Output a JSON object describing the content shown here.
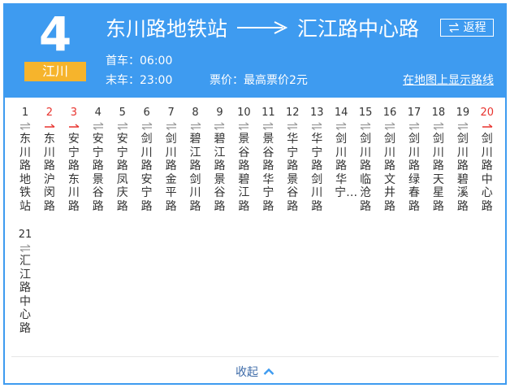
{
  "route": {
    "number": "4",
    "line_badge": "江川",
    "origin": "东川路地铁站",
    "destination": "汇江路中心路",
    "return_label": "返程",
    "first_bus": "首车：06:00",
    "last_bus": "末车：23:00",
    "fare": "票价：最高票价2元",
    "map_link": "在地图上显示路线"
  },
  "stations": [
    {
      "index": "1",
      "name": "东川路地铁站",
      "arrow": "both-icon",
      "highlight": false
    },
    {
      "index": "2",
      "name": "东川路沪闵路",
      "arrow": "right-arrow-icon",
      "highlight": true
    },
    {
      "index": "3",
      "name": "安宁路东川路",
      "arrow": "right-arrow-icon",
      "highlight": true
    },
    {
      "index": "4",
      "name": "安宁路景谷路",
      "arrow": "both-icon",
      "highlight": false
    },
    {
      "index": "5",
      "name": "安宁路凤庆路",
      "arrow": "both-icon",
      "highlight": false
    },
    {
      "index": "6",
      "name": "剑川路安宁路",
      "arrow": "both-icon",
      "highlight": false
    },
    {
      "index": "7",
      "name": "剑川路金平路",
      "arrow": "both-icon",
      "highlight": false
    },
    {
      "index": "8",
      "name": "碧江路剑川路",
      "arrow": "both-icon",
      "highlight": false
    },
    {
      "index": "9",
      "name": "碧江路景谷路",
      "arrow": "both-icon",
      "highlight": false
    },
    {
      "index": "10",
      "name": "景谷路碧江路",
      "arrow": "both-icon",
      "highlight": false
    },
    {
      "index": "11",
      "name": "景谷路华宁路",
      "arrow": "both-icon",
      "highlight": false
    },
    {
      "index": "12",
      "name": "华宁路景谷路",
      "arrow": "both-icon",
      "highlight": false
    },
    {
      "index": "13",
      "name": "华宁路剑川路",
      "arrow": "both-icon",
      "highlight": false
    },
    {
      "index": "14",
      "name": "剑川路华宁…",
      "arrow": "both-icon",
      "highlight": false
    },
    {
      "index": "15",
      "name": "剑川路临沧路",
      "arrow": "both-icon",
      "highlight": false
    },
    {
      "index": "16",
      "name": "剑川路文井路",
      "arrow": "both-icon",
      "highlight": false
    },
    {
      "index": "17",
      "name": "剑川路绿春路",
      "arrow": "both-icon",
      "highlight": false
    },
    {
      "index": "18",
      "name": "剑川路天星路",
      "arrow": "both-icon",
      "highlight": false
    },
    {
      "index": "19",
      "name": "剑川路碧溪路",
      "arrow": "both-icon",
      "highlight": false
    },
    {
      "index": "20",
      "name": "剑川路中心路",
      "arrow": "right-arrow-icon",
      "highlight": true
    },
    {
      "index": "21",
      "name": "汇江路中心路",
      "arrow": "both-icon",
      "highlight": false
    }
  ],
  "footer": {
    "collapse_label": "收起"
  },
  "colors": {
    "header_blue": "#3e9bf0",
    "badge_orange": "#f6b42c",
    "highlight_red": "#e8332e",
    "link_blue": "#3e6ba8"
  }
}
